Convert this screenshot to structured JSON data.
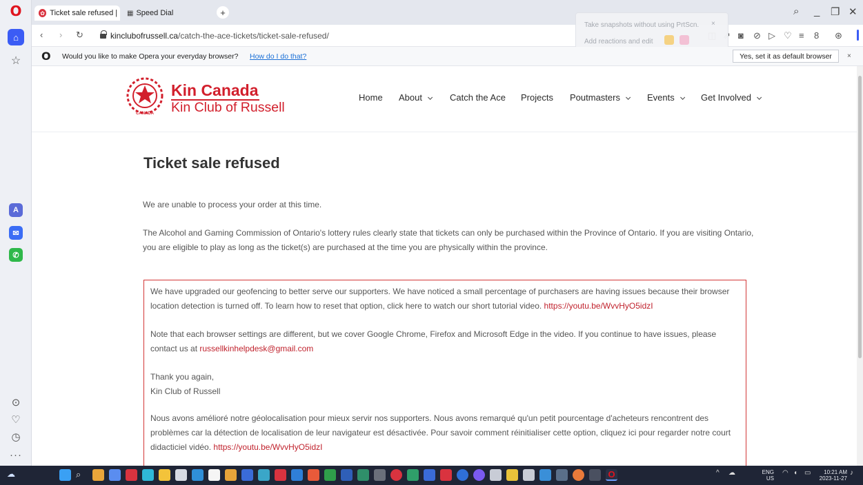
{
  "browser": {
    "tabs": [
      {
        "title": "Ticket sale refused | K",
        "active": true
      },
      {
        "title": "Speed Dial",
        "active": false
      }
    ],
    "url_domain": "kinclubofrussell.ca",
    "url_path": "/catch-the-ace-tickets/ticket-sale-refused/",
    "snapshot_popup": {
      "line1": "Take snapshots without using PrtScn.",
      "line2": "Add reactions and edit",
      "close": "×"
    },
    "default_bar": {
      "text": "Would you like to make Opera your everyday browser?",
      "link": "How do I do that?",
      "button": "Yes, set it as default browser",
      "close": "×"
    },
    "sidebar_icons": [
      "opera-logo-icon",
      "home-icon",
      "star-icon",
      "aria-icon",
      "messenger-icon",
      "whatsapp-icon",
      "player-icon",
      "heart-icon",
      "history-icon",
      "more-icon"
    ]
  },
  "site": {
    "logo": {
      "line1": "Kin Canada",
      "line2": "Kin Club of Russell",
      "emblem_text": "CANADA"
    },
    "nav": [
      {
        "label": "Home",
        "has_menu": false
      },
      {
        "label": "About",
        "has_menu": true
      },
      {
        "label": "Catch the Ace",
        "has_menu": false
      },
      {
        "label": "Projects",
        "has_menu": false
      },
      {
        "label": "Poutmasters",
        "has_menu": true
      },
      {
        "label": "Events",
        "has_menu": true
      },
      {
        "label": "Get Involved",
        "has_menu": true
      }
    ],
    "accent_color": "#d21f2c"
  },
  "content": {
    "title": "Ticket sale refused",
    "para1": "We are unable to process your order at this time.",
    "para2": "The Alcohol and Gaming Commission of Ontario's lottery rules clearly state that tickets can only be purchased within the Province of Ontario. If you are visiting Ontario, you are eligible to play as long as the ticket(s) are purchased at the time you are physically within the province.",
    "notice": {
      "p1_text": "We have upgraded our geofencing to better serve our supporters. We have noticed a small percentage of purchasers are having issues because their browser location detection is turned off. To learn how to reset that option, click here to watch our short tutorial video. ",
      "p1_link": "https://youtu.be/WvvHyO5idzI",
      "p2_text": "Note that each browser settings are different, but we cover Google Chrome, Firefox and Microsoft Edge in the video. If you continue to have issues, please contact us at ",
      "p2_link": "russellkinhelpdesk@gmail.com",
      "thanks": "Thank you again,",
      "sign": "Kin Club of Russell",
      "fr_text": "Nous avons amélioré notre géolocalisation pour mieux servir nos supporters. Nous avons remarqué qu'un petit pourcentage d'acheteurs rencontrent des problèmes car la détection de localisation de leur navigateur est désactivée. Pour savoir comment réinitialiser cette option, cliquez ici pour regarder notre court didacticiel vidéo. ",
      "fr_link": "https://youtu.be/WvvHyO5idzI"
    }
  },
  "taskbar": {
    "lang": "ENG",
    "region": "US",
    "time": "10:21 AM",
    "date": "2023-11-27"
  }
}
